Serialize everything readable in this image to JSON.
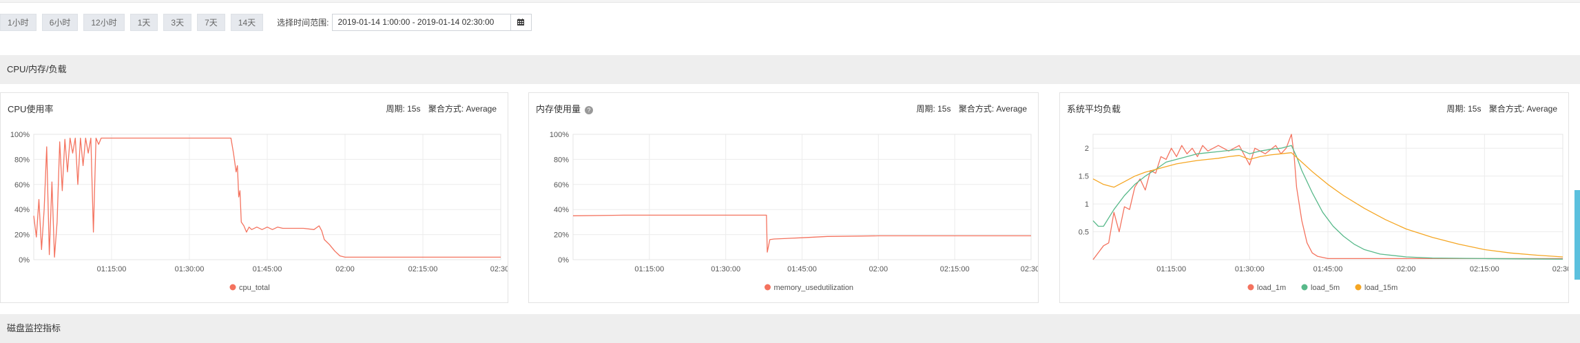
{
  "time_ranges": [
    "1小时",
    "6小时",
    "12小时",
    "1天",
    "3天",
    "7天",
    "14天"
  ],
  "date_range": {
    "label": "选择时间范围:",
    "value": "2019-01-14 1:00:00 - 2019-01-14 02:30:00"
  },
  "sections": {
    "cpu_mem_load": "CPU/内存/负载",
    "disk": "磁盘监控指标"
  },
  "panels": {
    "cpu": {
      "title": "CPU使用率",
      "period": "周期: 15s",
      "aggregation": "聚合方式: Average"
    },
    "memory": {
      "title": "内存使用量",
      "period": "周期: 15s",
      "aggregation": "聚合方式: Average"
    },
    "load": {
      "title": "系统平均负载",
      "period": "周期: 15s",
      "aggregation": "聚合方式: Average"
    }
  },
  "chart_data": [
    {
      "type": "line",
      "title": "CPU使用率",
      "x_ticks": [
        "01:15:00",
        "01:30:00",
        "01:45:00",
        "02:00",
        "02:15:00",
        "02:30:"
      ],
      "y_ticks": [
        "0%",
        "20%",
        "40%",
        "60%",
        "80%",
        "100%"
      ],
      "xlim": [
        "01:00:00",
        "02:30:00"
      ],
      "ylim": [
        0,
        100
      ],
      "series": [
        {
          "name": "cpu_total",
          "color": "#f4725e",
          "points": [
            [
              "01:00:00",
              35
            ],
            [
              "01:00:30",
              18
            ],
            [
              "01:01:00",
              48
            ],
            [
              "01:01:30",
              8
            ],
            [
              "01:02:00",
              40
            ],
            [
              "01:02:30",
              90
            ],
            [
              "01:03:00",
              4
            ],
            [
              "01:03:30",
              62
            ],
            [
              "01:04:00",
              2
            ],
            [
              "01:04:30",
              30
            ],
            [
              "01:05:00",
              94
            ],
            [
              "01:05:30",
              55
            ],
            [
              "01:06:00",
              96
            ],
            [
              "01:06:30",
              70
            ],
            [
              "01:07:00",
              97
            ],
            [
              "01:07:30",
              85
            ],
            [
              "01:08:00",
              97
            ],
            [
              "01:08:30",
              60
            ],
            [
              "01:09:00",
              97
            ],
            [
              "01:09:30",
              75
            ],
            [
              "01:10:00",
              97
            ],
            [
              "01:10:30",
              85
            ],
            [
              "01:11:00",
              97
            ],
            [
              "01:11:30",
              22
            ],
            [
              "01:12:00",
              97
            ],
            [
              "01:12:30",
              92
            ],
            [
              "01:13:00",
              97
            ],
            [
              "01:15:00",
              97
            ],
            [
              "01:20:00",
              97
            ],
            [
              "01:30:00",
              97
            ],
            [
              "01:37:00",
              97
            ],
            [
              "01:38:00",
              97
            ],
            [
              "01:38:30",
              85
            ],
            [
              "01:39:00",
              70
            ],
            [
              "01:39:15",
              75
            ],
            [
              "01:39:30",
              50
            ],
            [
              "01:39:45",
              55
            ],
            [
              "01:40:00",
              30
            ],
            [
              "01:40:30",
              27
            ],
            [
              "01:41:00",
              22
            ],
            [
              "01:41:30",
              26
            ],
            [
              "01:42:00",
              24
            ],
            [
              "01:43:00",
              26
            ],
            [
              "01:44:00",
              24
            ],
            [
              "01:45:00",
              26
            ],
            [
              "01:46:00",
              24
            ],
            [
              "01:47:00",
              26
            ],
            [
              "01:48:00",
              25
            ],
            [
              "01:50:00",
              25
            ],
            [
              "01:52:00",
              25
            ],
            [
              "01:54:00",
              24
            ],
            [
              "01:55:00",
              27
            ],
            [
              "01:55:30",
              23
            ],
            [
              "01:56:00",
              16
            ],
            [
              "01:57:00",
              12
            ],
            [
              "01:58:00",
              7
            ],
            [
              "01:59:00",
              3
            ],
            [
              "02:00:00",
              2
            ],
            [
              "02:10:00",
              2
            ],
            [
              "02:20:00",
              2
            ],
            [
              "02:30:00",
              2
            ]
          ]
        }
      ]
    },
    {
      "type": "line",
      "title": "内存使用量",
      "x_ticks": [
        "01:15:00",
        "01:30:00",
        "01:45:00",
        "02:00",
        "02:15:00",
        "02:30:"
      ],
      "y_ticks": [
        "0%",
        "20%",
        "40%",
        "60%",
        "80%",
        "100%"
      ],
      "xlim": [
        "01:00:00",
        "02:30:00"
      ],
      "ylim": [
        0,
        100
      ],
      "series": [
        {
          "name": "memory_usedutilization",
          "color": "#f4725e",
          "points": [
            [
              "01:00:00",
              35
            ],
            [
              "01:10:00",
              35.5
            ],
            [
              "01:20:00",
              35.5
            ],
            [
              "01:30:00",
              35.5
            ],
            [
              "01:38:00",
              35.5
            ],
            [
              "01:38:10",
              6
            ],
            [
              "01:38:40",
              16
            ],
            [
              "01:39:30",
              16.5
            ],
            [
              "01:45:00",
              17.5
            ],
            [
              "01:50:00",
              18.5
            ],
            [
              "02:00:00",
              19
            ],
            [
              "02:15:00",
              19
            ],
            [
              "02:30:00",
              19
            ]
          ]
        }
      ]
    },
    {
      "type": "line",
      "title": "系统平均负载",
      "x_ticks": [
        "01:15:00",
        "01:30:00",
        "01:45:00",
        "02:00",
        "02:15:00",
        "02:30:"
      ],
      "y_ticks": [
        "0.5",
        "1",
        "1.5",
        "2"
      ],
      "xlim": [
        "01:00:00",
        "02:30:00"
      ],
      "ylim": [
        0,
        2.25
      ],
      "series": [
        {
          "name": "load_1m",
          "color": "#f4725e",
          "points": [
            [
              "01:00:00",
              0
            ],
            [
              "01:02:00",
              0.25
            ],
            [
              "01:03:00",
              0.3
            ],
            [
              "01:04:00",
              0.85
            ],
            [
              "01:05:00",
              0.5
            ],
            [
              "01:06:00",
              0.95
            ],
            [
              "01:07:00",
              0.9
            ],
            [
              "01:08:00",
              1.3
            ],
            [
              "01:09:00",
              1.45
            ],
            [
              "01:10:00",
              1.25
            ],
            [
              "01:11:00",
              1.6
            ],
            [
              "01:12:00",
              1.55
            ],
            [
              "01:13:00",
              1.85
            ],
            [
              "01:14:00",
              1.8
            ],
            [
              "01:15:00",
              2.0
            ],
            [
              "01:16:00",
              1.85
            ],
            [
              "01:17:00",
              2.05
            ],
            [
              "01:18:00",
              1.9
            ],
            [
              "01:19:00",
              2.0
            ],
            [
              "01:20:00",
              1.85
            ],
            [
              "01:21:00",
              2.05
            ],
            [
              "01:22:00",
              1.95
            ],
            [
              "01:24:00",
              2.05
            ],
            [
              "01:26:00",
              1.95
            ],
            [
              "01:28:00",
              2.05
            ],
            [
              "01:30:00",
              1.7
            ],
            [
              "01:31:00",
              2.0
            ],
            [
              "01:33:00",
              1.9
            ],
            [
              "01:35:00",
              2.05
            ],
            [
              "01:36:00",
              1.9
            ],
            [
              "01:37:00",
              2.0
            ],
            [
              "01:38:00",
              2.25
            ],
            [
              "01:38:30",
              1.9
            ],
            [
              "01:39:00",
              1.3
            ],
            [
              "01:40:00",
              0.7
            ],
            [
              "01:41:00",
              0.3
            ],
            [
              "01:42:00",
              0.12
            ],
            [
              "01:43:00",
              0.06
            ],
            [
              "01:45:00",
              0.02
            ],
            [
              "01:50:00",
              0.02
            ],
            [
              "02:00:00",
              0.02
            ],
            [
              "02:10:00",
              0.02
            ],
            [
              "02:20:00",
              0.02
            ],
            [
              "02:30:00",
              0.02
            ]
          ]
        },
        {
          "name": "load_5m",
          "color": "#58b98a",
          "points": [
            [
              "01:00:00",
              0.7
            ],
            [
              "01:01:00",
              0.6
            ],
            [
              "01:02:00",
              0.6
            ],
            [
              "01:04:00",
              0.9
            ],
            [
              "01:06:00",
              1.15
            ],
            [
              "01:08:00",
              1.35
            ],
            [
              "01:10:00",
              1.5
            ],
            [
              "01:12:00",
              1.62
            ],
            [
              "01:14:00",
              1.75
            ],
            [
              "01:16:00",
              1.8
            ],
            [
              "01:18:00",
              1.85
            ],
            [
              "01:20:00",
              1.9
            ],
            [
              "01:22:00",
              1.92
            ],
            [
              "01:24:00",
              1.94
            ],
            [
              "01:26:00",
              1.96
            ],
            [
              "01:28:00",
              1.98
            ],
            [
              "01:30:00",
              1.9
            ],
            [
              "01:32:00",
              1.95
            ],
            [
              "01:34:00",
              1.98
            ],
            [
              "01:36:00",
              2.0
            ],
            [
              "01:38:00",
              2.05
            ],
            [
              "01:39:00",
              1.85
            ],
            [
              "01:40:00",
              1.6
            ],
            [
              "01:42:00",
              1.2
            ],
            [
              "01:44:00",
              0.85
            ],
            [
              "01:46:00",
              0.6
            ],
            [
              "01:48:00",
              0.42
            ],
            [
              "01:50:00",
              0.28
            ],
            [
              "01:52:00",
              0.18
            ],
            [
              "01:55:00",
              0.1
            ],
            [
              "02:00:00",
              0.05
            ],
            [
              "02:05:00",
              0.03
            ],
            [
              "02:15:00",
              0.02
            ],
            [
              "02:30:00",
              0.01
            ]
          ]
        },
        {
          "name": "load_15m",
          "color": "#f5a623",
          "points": [
            [
              "01:00:00",
              1.45
            ],
            [
              "01:02:00",
              1.35
            ],
            [
              "01:04:00",
              1.3
            ],
            [
              "01:06:00",
              1.4
            ],
            [
              "01:08:00",
              1.5
            ],
            [
              "01:10:00",
              1.57
            ],
            [
              "01:12:00",
              1.62
            ],
            [
              "01:14:00",
              1.67
            ],
            [
              "01:16:00",
              1.72
            ],
            [
              "01:18:00",
              1.75
            ],
            [
              "01:20:00",
              1.78
            ],
            [
              "01:22:00",
              1.8
            ],
            [
              "01:24:00",
              1.82
            ],
            [
              "01:26:00",
              1.85
            ],
            [
              "01:28:00",
              1.87
            ],
            [
              "01:30:00",
              1.8
            ],
            [
              "01:32:00",
              1.85
            ],
            [
              "01:34:00",
              1.88
            ],
            [
              "01:36:00",
              1.9
            ],
            [
              "01:38:00",
              1.92
            ],
            [
              "01:40:00",
              1.75
            ],
            [
              "01:42:00",
              1.58
            ],
            [
              "01:45:00",
              1.35
            ],
            [
              "01:48:00",
              1.15
            ],
            [
              "01:52:00",
              0.92
            ],
            [
              "01:56:00",
              0.72
            ],
            [
              "02:00:00",
              0.55
            ],
            [
              "02:05:00",
              0.4
            ],
            [
              "02:10:00",
              0.28
            ],
            [
              "02:15:00",
              0.18
            ],
            [
              "02:20:00",
              0.12
            ],
            [
              "02:25:00",
              0.08
            ],
            [
              "02:30:00",
              0.05
            ]
          ]
        }
      ]
    }
  ]
}
